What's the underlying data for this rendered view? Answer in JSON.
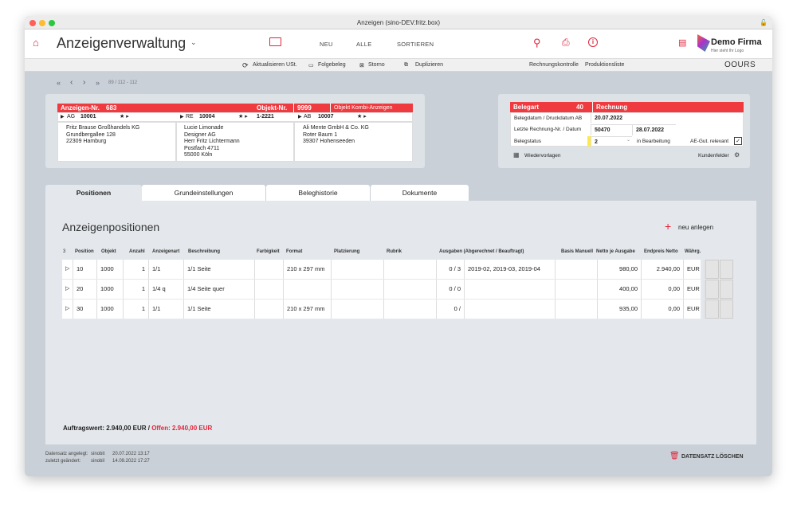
{
  "window": {
    "title": "Anzeigen (sino-DEV.fritz.box)"
  },
  "header": {
    "title": "Anzeigenverwaltung",
    "nav": [
      "NEU",
      "ALLE",
      "SORTIEREN"
    ],
    "brand": {
      "name": "Demo Firma",
      "tagline": "Hier steht Ihr Logo"
    }
  },
  "toolbar": {
    "items": [
      "Aktualisieren USt.",
      "Folgebeleg",
      "Storno",
      "Duplizieren"
    ],
    "right": [
      "Rechnungskontrolle",
      "Produktionsliste"
    ],
    "logo": "OOURS"
  },
  "pager": {
    "text": "89 / 112 - 112"
  },
  "anzeige": {
    "nr_label": "Anzeigen-Nr.",
    "nr": "683",
    "objekt_label": "Objekt-Nr.",
    "objekt_nr": "9999",
    "objekt_name": "Objekt Kombi-Anzeigen",
    "ag": {
      "label": "AG",
      "nr": "10001",
      "lines": [
        "Fritz Brause Großhandels KG",
        "Grundbergallee 128",
        "22309 Hamburg"
      ]
    },
    "re": {
      "label": "RE",
      "nr": "10004",
      "extra": "1-2221",
      "lines": [
        "Lucie Limonade",
        "Designer AG",
        "Herr Fritz Lichtermann",
        "Postfach 4711",
        "55000 Köln"
      ]
    },
    "ab": {
      "label": "AB",
      "nr": "10007",
      "lines": [
        "Ali Mente GmbH & Co. KG",
        "Roter Baum 1",
        "39307 Hohenseeden"
      ]
    }
  },
  "beleg": {
    "art_label": "Belegart",
    "art_nr": "40",
    "art": "Rechnung",
    "datum_label": "Belegdatum / Druckdatum AB",
    "datum": "20.07.2022",
    "letzte_label": "Letzte Rechnung-Nr. / Datum",
    "letzte_nr": "50470",
    "letzte_datum": "28.07.2022",
    "status_label": "Belegstatus",
    "status": "2",
    "status_text": "in Bearbeitung",
    "ae_label": "AE-Gut. relevant",
    "ae_check": "✓",
    "wiedervorlagen": "Wiedervorlagen",
    "kundenfelder": "Kundenfelder"
  },
  "tabs": [
    "Positionen",
    "Grundeinstellungen",
    "Beleghistorie",
    "Dokumente"
  ],
  "positions": {
    "title": "Anzeigenpositionen",
    "new_label": "neu anlegen",
    "count": "3",
    "columns": [
      "Position",
      "Objekt",
      "Anzahl",
      "Anzeigenart",
      "Beschreibung",
      "Farbigkeit",
      "Format",
      "Platzierung",
      "Rubrik",
      "Ausgaben (Abgerechnet / Beauftragt)",
      "Basis Manuell",
      "Netto je Ausgabe",
      "Endpreis Netto",
      "Währg."
    ],
    "rows": [
      {
        "pos": "10",
        "objekt": "1000",
        "anzahl": "1",
        "art": "1/1",
        "beschr": "1/1 Seite",
        "farbe": "",
        "format": "210 x 297 mm",
        "platz": "",
        "rubrik": "",
        "ausg": "0 / 3",
        "ausg_list": "2019-02, 2019-03, 2019-04",
        "basis": "",
        "netto": "980,00",
        "end": "2.940,00",
        "cur": "EUR"
      },
      {
        "pos": "20",
        "objekt": "1000",
        "anzahl": "1",
        "art": "1/4 q",
        "beschr": "1/4 Seite quer",
        "farbe": "",
        "format": "",
        "platz": "",
        "rubrik": "",
        "ausg": "0 / 0",
        "ausg_list": "",
        "basis": "",
        "netto": "400,00",
        "end": "0,00",
        "cur": "EUR"
      },
      {
        "pos": "30",
        "objekt": "1000",
        "anzahl": "1",
        "art": "1/1",
        "beschr": "1/1 Seite",
        "farbe": "",
        "format": "210 x 297 mm",
        "platz": "",
        "rubrik": "",
        "ausg": "0 /",
        "ausg_list": "",
        "basis": "",
        "netto": "935,00",
        "end": "0,00",
        "cur": "EUR"
      }
    ],
    "summary": {
      "label": "Auftragswert:",
      "value": "2.940,00",
      "cur": "EUR /",
      "offen_label": "Offen:",
      "offen": "2.940,00",
      "offen_cur": "EUR"
    }
  },
  "footer": {
    "angelegt_label": "Datensatz angelegt:",
    "angelegt_user": "sinobit",
    "angelegt_date": "20.07.2022 13:17",
    "geaendert_label": "zuletzt geändert:",
    "geaendert_user": "sinobil",
    "geaendert_date": "14.09.2022 17:27",
    "delete_label": "DATENSATZ LÖSCHEN"
  }
}
